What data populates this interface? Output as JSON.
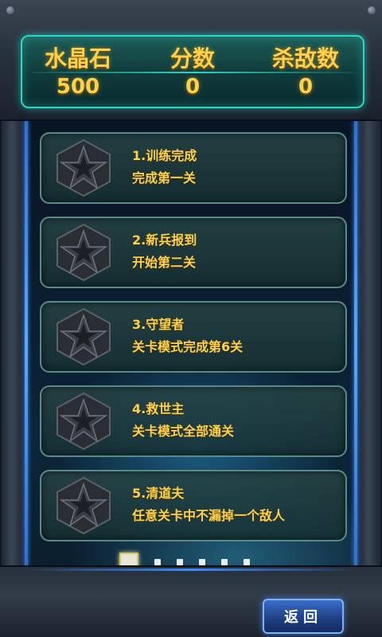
{
  "stats": {
    "labels": [
      "水晶石",
      "分数",
      "杀敌数"
    ],
    "values": [
      "500",
      "0",
      "0"
    ]
  },
  "achievements": [
    {
      "title": "1.训练完成",
      "desc": "完成第一关",
      "icon": "star-badge-icon"
    },
    {
      "title": "2.新兵报到",
      "desc": "开始第二关",
      "icon": "star-badge-icon"
    },
    {
      "title": "3.守望者",
      "desc": "关卡模式完成第6关",
      "icon": "star-badge-icon"
    },
    {
      "title": "4.救世主",
      "desc": "关卡模式全部通关",
      "icon": "star-badge-icon"
    },
    {
      "title": "5.清道夫",
      "desc": "任意关卡中不漏掉一个敌人",
      "icon": "star-badge-icon"
    }
  ],
  "pager": {
    "total": 6,
    "current": 1
  },
  "buttons": {
    "back_label": "返回"
  },
  "colors": {
    "accent_gold": "#ffd04a",
    "panel_teal": "#2bd7c4",
    "button_blue": "#3a6ec8"
  }
}
